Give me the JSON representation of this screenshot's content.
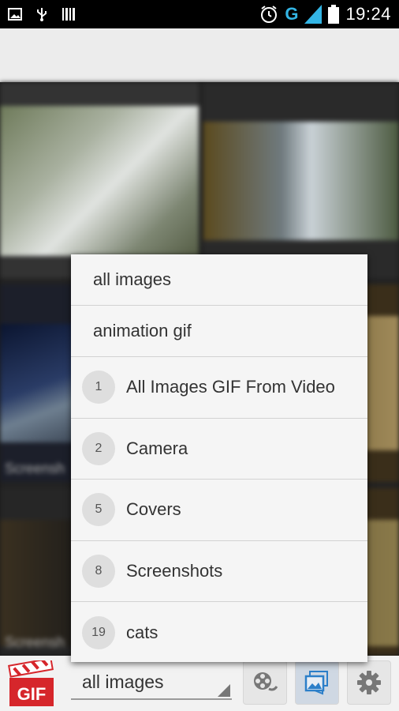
{
  "status_bar": {
    "time": "19:24",
    "network_letter": "G",
    "icons": [
      "image-icon",
      "usb-icon",
      "barcode-icon",
      "alarm-icon",
      "signal-icon",
      "battery-icon"
    ]
  },
  "gallery": {
    "tile_labels": [
      "Screensh",
      "Screensh"
    ]
  },
  "dropdown": {
    "filters": [
      {
        "label": "all images"
      },
      {
        "label": "animation gif"
      }
    ],
    "albums": [
      {
        "count": "1",
        "name": "All Images GIF From Video"
      },
      {
        "count": "2",
        "name": "Camera"
      },
      {
        "count": "5",
        "name": "Covers"
      },
      {
        "count": "8",
        "name": "Screenshots"
      },
      {
        "count": "19",
        "name": "cats"
      }
    ]
  },
  "bottom_bar": {
    "logo_text": "GIF",
    "spinner_value": "all images",
    "buttons": [
      "video-reel-icon",
      "gallery-icon",
      "gear-icon"
    ]
  },
  "colors": {
    "accent": "#33b5e5",
    "logo_red": "#d6262b",
    "gallery_icon_blue": "#2c7fc9"
  }
}
